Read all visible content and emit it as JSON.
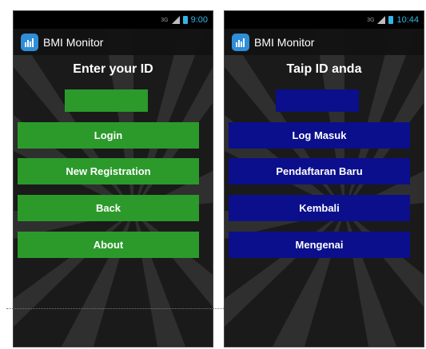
{
  "phones": {
    "english": {
      "status_bar": {
        "network": "3G",
        "time": "9:00"
      },
      "action_bar": {
        "app_icon": "bmi-app-icon",
        "title": "BMI Monitor"
      },
      "heading": "Enter your ID",
      "id_input": {
        "value": "",
        "placeholder": ""
      },
      "buttons": {
        "login": "Login",
        "new_registration": "New Registration",
        "back": "Back",
        "about": "About"
      },
      "accent_color": "#2b9a2b"
    },
    "malay": {
      "status_bar": {
        "network": "3G",
        "time": "10:44"
      },
      "action_bar": {
        "app_icon": "bmi-app-icon",
        "title": "BMI Monitor"
      },
      "heading": "Taip ID anda",
      "id_input": {
        "value": "",
        "placeholder": ""
      },
      "buttons": {
        "login": "Log Masuk",
        "new_registration": "Pendaftaran Baru",
        "back": "Kembali",
        "about": "Mengenai"
      },
      "accent_color": "#0b0f8c"
    }
  },
  "colors": {
    "status_time": "#33b5e5",
    "app_icon_bg": "#2f8ed8",
    "background": "#1b1b1b"
  }
}
